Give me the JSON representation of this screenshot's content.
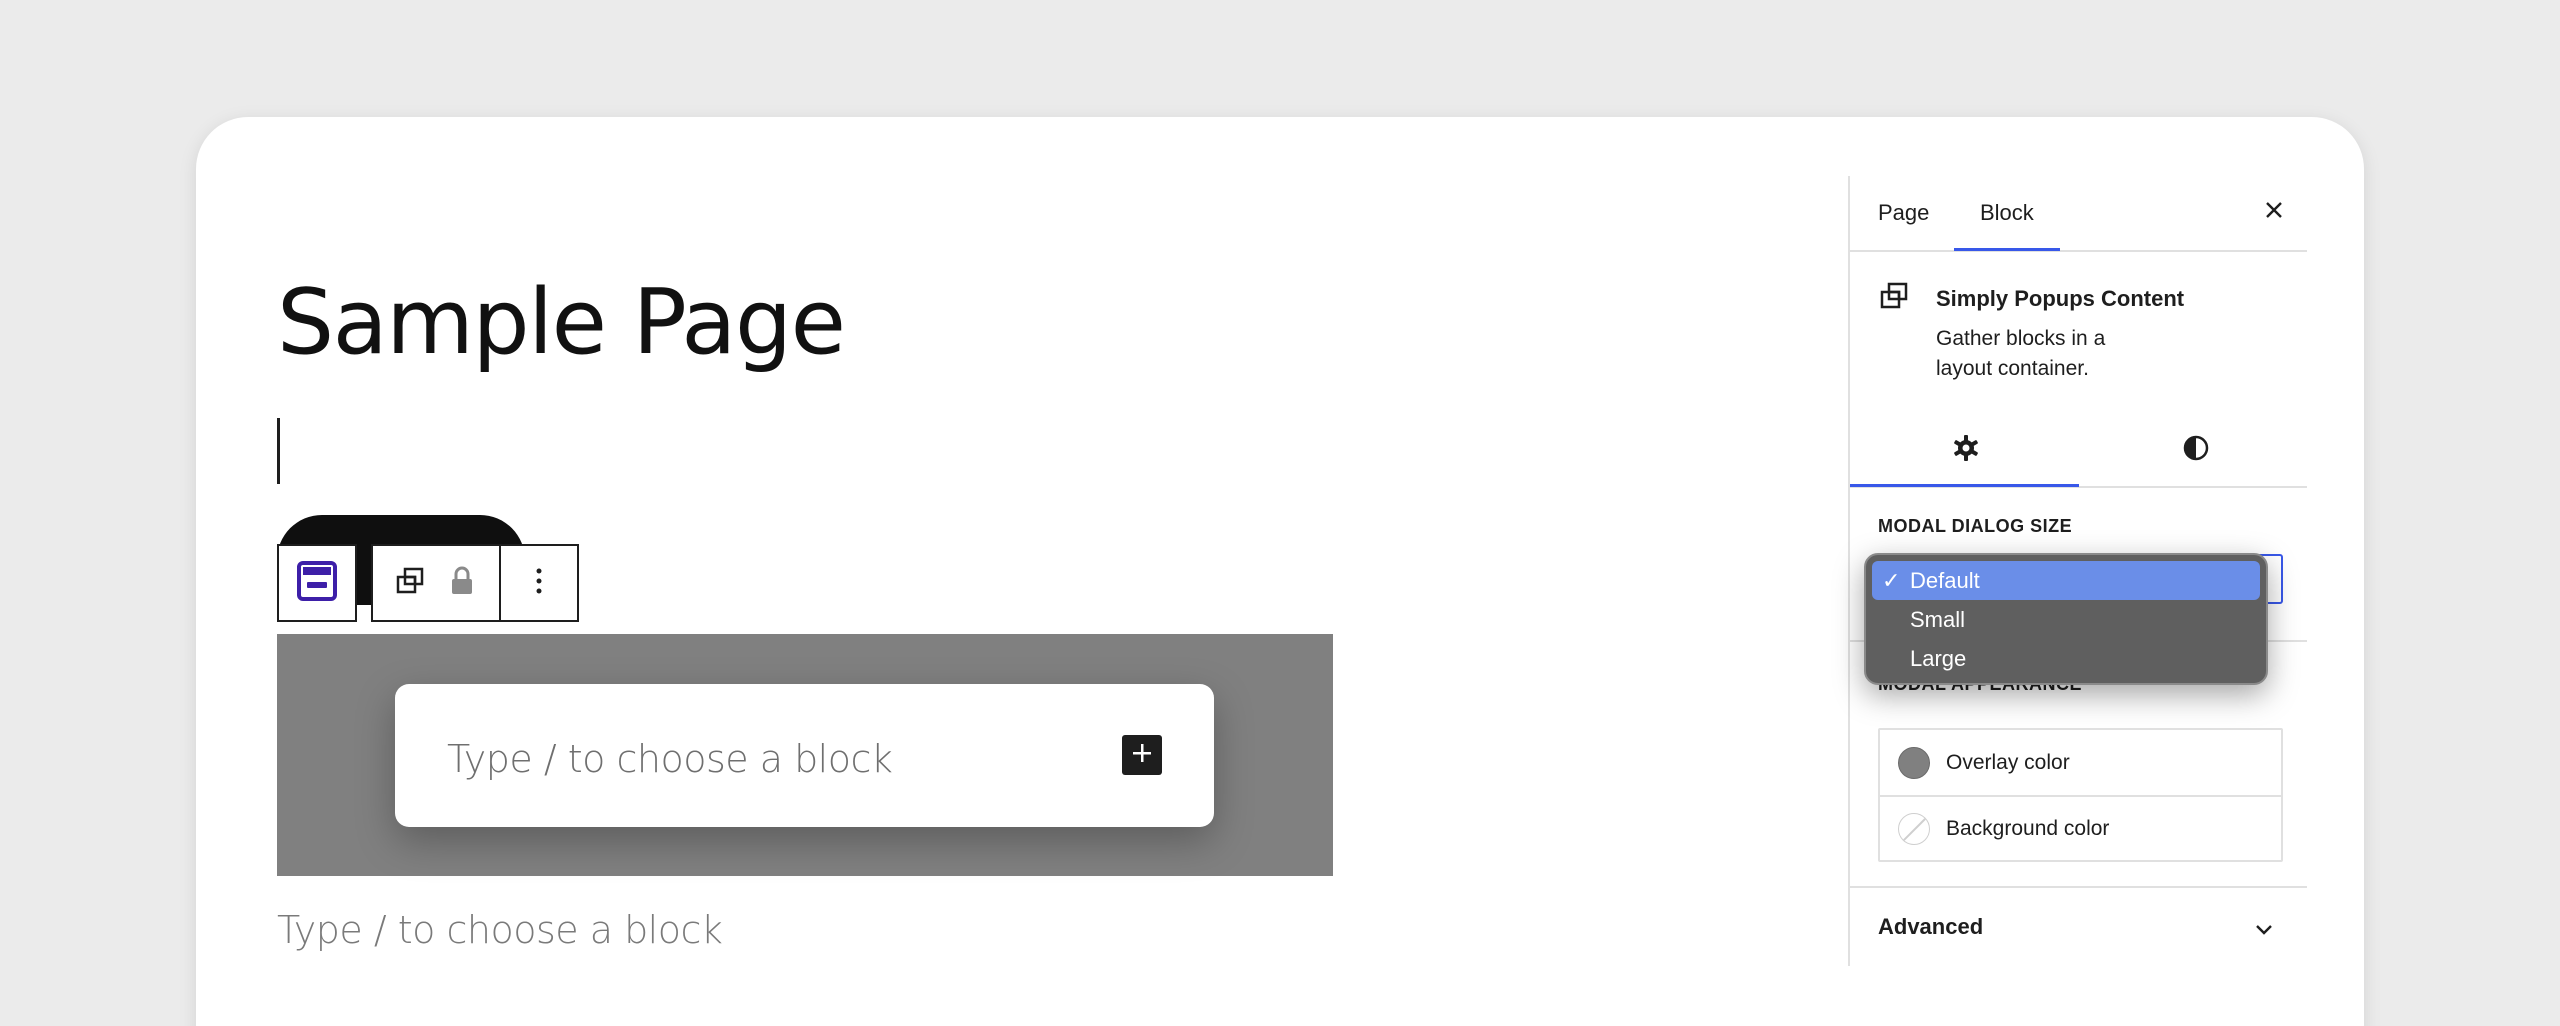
{
  "editor": {
    "page_title": "Sample Page",
    "modal_placeholder": "Type / to choose a block",
    "bottom_placeholder": "Type / to choose a block",
    "toolbar": {
      "icons": [
        "popup-block-icon",
        "popups-content-icon",
        "lock-icon",
        "more-options-icon"
      ]
    }
  },
  "sidebar": {
    "tabs": {
      "page": "Page",
      "block": "Block"
    },
    "block_card": {
      "name": "Simply Popups Content",
      "description": "Gather blocks in a layout container."
    },
    "modal_dialog_size_label": "MODAL DIALOG SIZE",
    "modal_appearance_label": "MODAL APPEARANCE",
    "colors": [
      {
        "label": "Overlay color",
        "value": "#808080"
      },
      {
        "label": "Background color",
        "value": "none"
      }
    ],
    "advanced_label": "Advanced"
  },
  "dropdown": {
    "selected": "Default",
    "options": [
      "Default",
      "Small",
      "Large"
    ],
    "check_glyph": "✓"
  },
  "colors": {
    "accent": "#3858e9",
    "dropdown_highlight": "#6a8ee8",
    "overlay_gray": "#808080"
  }
}
